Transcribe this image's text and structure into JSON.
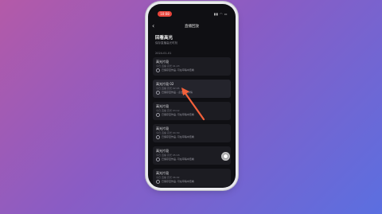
{
  "header": {
    "title": "直播回放",
    "back_icon": "chevron-left-icon"
  },
  "status_bar": {
    "time": "10:08",
    "icons": "signal wifi battery"
  },
  "section": {
    "title": "回看高光",
    "subtitle": "保存直播高光时刻"
  },
  "date_label": "2024-01-01",
  "cards": [
    {
      "title": "高光片段",
      "meta": "今日 直播 高光 01:23",
      "note": "已保存至作品, 可在草稿中查看"
    },
    {
      "title": "高光片段 02",
      "meta": "今日 直播 高光 02:45",
      "note": "已保存至作品 - 点击查看详情"
    },
    {
      "title": "高光片段",
      "meta": "今日 直播 高光 03:12",
      "note": "已保存至作品, 可在草稿中查看"
    },
    {
      "title": "高光片段",
      "meta": "今日 直播 高光 04:30",
      "note": "已保存至作品, 可在草稿中查看"
    },
    {
      "title": "高光片段",
      "meta": "今日 直播 高光 05:18",
      "note": "已保存至作品, 可在草稿中查看"
    },
    {
      "title": "高光片段",
      "meta": "今日 直播 高光 06:02",
      "note": "已保存至作品, 可在草稿中查看"
    }
  ],
  "colors": {
    "accent": "#e8453c",
    "arrow": "#f2603a",
    "background_start": "#b45aa8",
    "background_end": "#5b6fe0"
  }
}
